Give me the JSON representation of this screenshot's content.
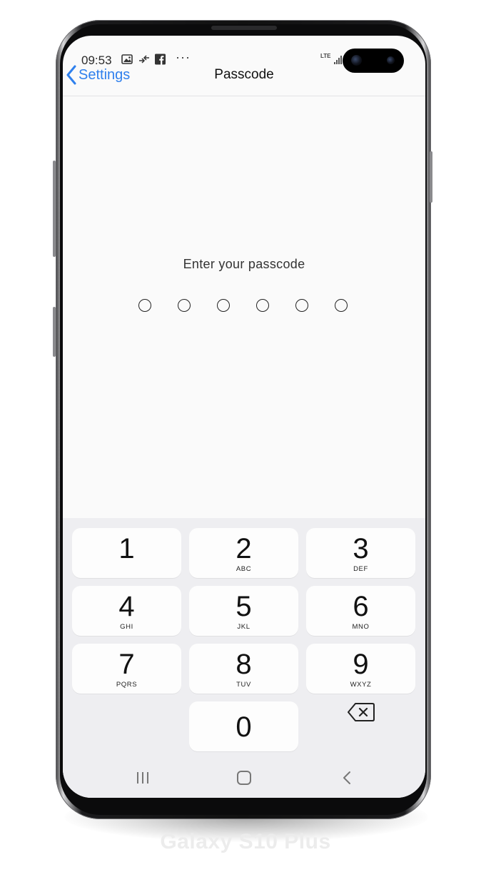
{
  "status_bar": {
    "time": "09:53",
    "network": "LTE",
    "more": "···"
  },
  "header": {
    "back_label": "Settings",
    "title": "Passcode"
  },
  "passcode": {
    "prompt": "Enter your passcode",
    "length": 6,
    "filled": 0
  },
  "keypad": {
    "keys": [
      {
        "digit": "1",
        "letters": ""
      },
      {
        "digit": "2",
        "letters": "ABC"
      },
      {
        "digit": "3",
        "letters": "DEF"
      },
      {
        "digit": "4",
        "letters": "GHI"
      },
      {
        "digit": "5",
        "letters": "JKL"
      },
      {
        "digit": "6",
        "letters": "MNO"
      },
      {
        "digit": "7",
        "letters": "PQRS"
      },
      {
        "digit": "8",
        "letters": "TUV"
      },
      {
        "digit": "9",
        "letters": "WXYZ"
      },
      {
        "digit": "0",
        "letters": ""
      }
    ]
  },
  "device": {
    "model": "Galaxy S10 Plus"
  },
  "colors": {
    "accent": "#2f80ed",
    "keypad_bg": "#eeeef1",
    "key_bg": "#fdfdfd"
  }
}
